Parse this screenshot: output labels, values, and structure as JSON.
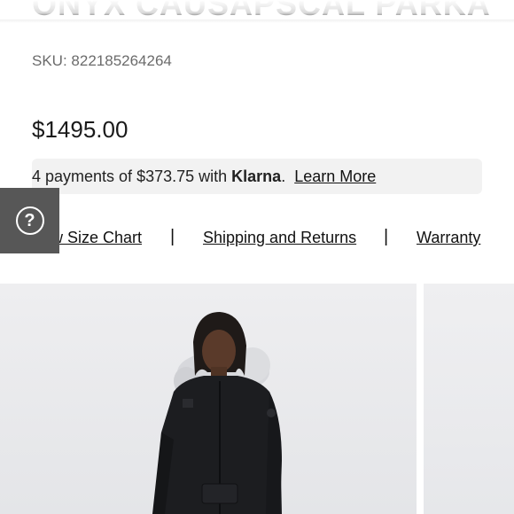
{
  "product": {
    "title": "ONYX CAUSAPSCAL PARKA",
    "sku_label": "SKU:",
    "sku": "822185264264",
    "price": "$1495.00"
  },
  "payments": {
    "text_prefix": "4 payments of $373.75 with",
    "brand": "Klarna",
    "text_suffix": ".",
    "learn_more": "Learn More"
  },
  "links": {
    "size_chart": "w Size Chart",
    "separator": "|",
    "shipping": "Shipping and Returns",
    "warranty": "Warranty"
  },
  "help": {
    "icon": "help-question-icon",
    "glyph": "?"
  },
  "colors": {
    "help_bg": "#575757",
    "klarna_bar_bg": "#f2f2f2",
    "photo_bg": "#e8e9ec"
  }
}
